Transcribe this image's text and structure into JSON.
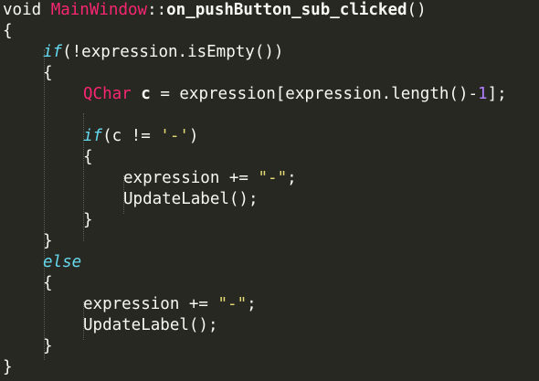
{
  "code": {
    "l1": {
      "type": "void",
      "class": "MainWindow",
      "scope": "::",
      "func": "on_pushButton_sub_clicked",
      "parens": "()"
    },
    "l2": {
      "brace": "{"
    },
    "l3": {
      "kw": "if",
      "open": "(!",
      "ident": "expression",
      "dot": ".",
      "method": "isEmpty",
      "close": "())"
    },
    "l4": {
      "brace": "{"
    },
    "l5": {
      "type": "QChar",
      "var": "c",
      "assign": " = ",
      "ident": "expression",
      "bracket_open": "[",
      "ident2": "expression",
      "dot": ".",
      "method": "length",
      "call": "()-",
      "num": "1",
      "end": "];"
    },
    "l6": {
      "kw": "if",
      "cond": "(c != ",
      "str": "'-'",
      "close": ")"
    },
    "l7": {
      "brace": "{"
    },
    "l8": {
      "ident": "expression",
      "op": " += ",
      "str": "\"-\"",
      "end": ";"
    },
    "l9": {
      "call": "UpdateLabel();"
    },
    "l10": {
      "brace": "}"
    },
    "l11": {
      "brace": "}"
    },
    "l12": {
      "kw": "else"
    },
    "l13": {
      "brace": "{"
    },
    "l14": {
      "ident": "expression",
      "op": " += ",
      "str": "\"-\"",
      "end": ";"
    },
    "l15": {
      "call": "UpdateLabel();"
    },
    "l16": {
      "brace": "}"
    },
    "l17": {
      "brace": "}"
    }
  },
  "colors": {
    "background": "#272822",
    "text": "#f8f8f2",
    "keyword": "#66d9ef",
    "type": "#f92672",
    "number": "#ae81ff",
    "string": "#e6db74",
    "indent_guide": "#5a5b52"
  }
}
